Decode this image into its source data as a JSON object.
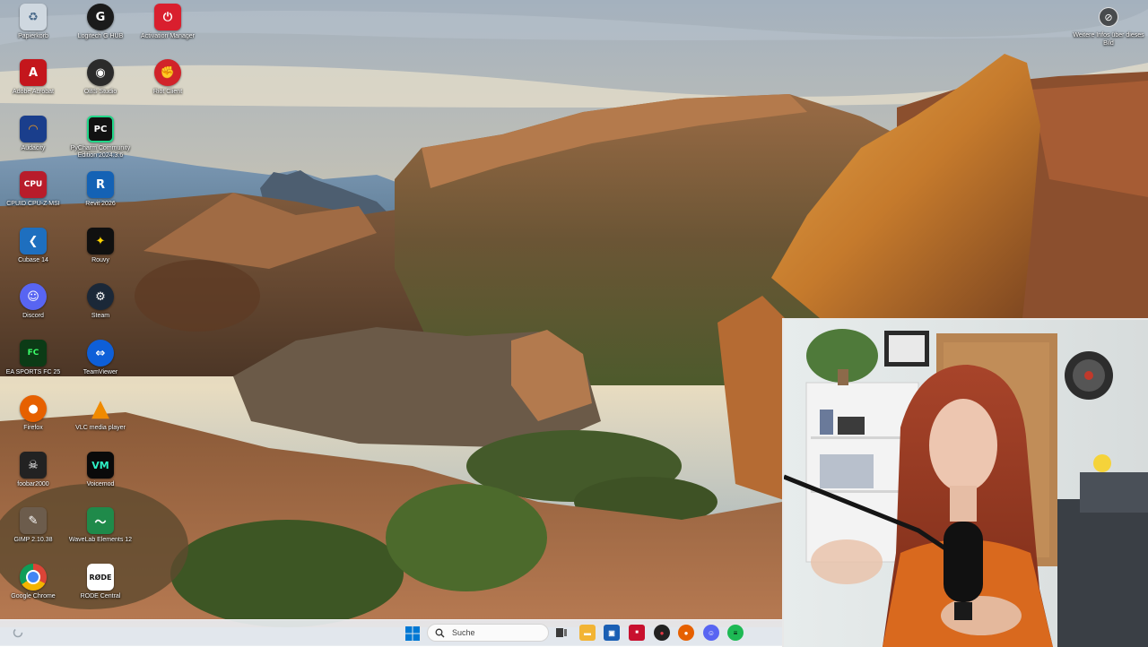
{
  "desktop": {
    "icons": [
      {
        "label": "Papierkorb",
        "icon": "recycle-bin-icon",
        "color": "#cfd8e0"
      },
      {
        "label": "Logitech G HUB",
        "icon": "logitech-g-icon",
        "color": "#1b1b1b"
      },
      {
        "label": "Activation Manager",
        "icon": "activation-manager-icon",
        "color": "#d91f2e"
      },
      {
        "label": "Adobe Acrobat",
        "icon": "adobe-acrobat-icon",
        "color": "#c4161c"
      },
      {
        "label": "OBS Studio",
        "icon": "obs-studio-icon",
        "color": "#2b2b2b"
      },
      {
        "label": "Riot Client",
        "icon": "riot-client-icon",
        "color": "#d1232a"
      },
      {
        "label": "Audacity",
        "icon": "audacity-icon",
        "color": "#1a3e8c"
      },
      {
        "label": "PyCharm Community Edition 2024.3.6",
        "icon": "pycharm-icon",
        "color": "#121212"
      },
      {
        "label": "CPUID CPU-Z MSI",
        "icon": "cpu-z-icon",
        "color": "#b81c2b"
      },
      {
        "label": "Revit 2026",
        "icon": "revit-icon",
        "color": "#1462b5"
      },
      {
        "label": "Cubase 14",
        "icon": "cubase-icon",
        "color": "#1e6fbf"
      },
      {
        "label": "Rouvy",
        "icon": "rouvy-icon",
        "color": "#101010"
      },
      {
        "label": "Discord",
        "icon": "discord-icon",
        "color": "#5865f2"
      },
      {
        "label": "Steam",
        "icon": "steam-icon",
        "color": "#1b2838"
      },
      {
        "label": "EA SPORTS FC 25",
        "icon": "ea-sports-fc-icon",
        "color": "#0c3b16"
      },
      {
        "label": "TeamViewer",
        "icon": "teamviewer-icon",
        "color": "#0e5fd8"
      },
      {
        "label": "Firefox",
        "icon": "firefox-icon",
        "color": "#e66000"
      },
      {
        "label": "VLC media player",
        "icon": "vlc-icon",
        "color": "#f08a00"
      },
      {
        "label": "foobar2000",
        "icon": "foobar2000-icon",
        "color": "#222222"
      },
      {
        "label": "Voicemod",
        "icon": "voicemod-icon",
        "color": "#0a0a0a"
      },
      {
        "label": "GIMP 2.10.38",
        "icon": "gimp-icon",
        "color": "#6c5c4c"
      },
      {
        "label": "WaveLab Elements 12",
        "icon": "wavelab-icon",
        "color": "#1f8a4a"
      },
      {
        "label": "Google Chrome",
        "icon": "chrome-icon",
        "color": "#ffffff"
      },
      {
        "label": "RODE Central",
        "icon": "rode-central-icon",
        "color": "#ffffff"
      }
    ],
    "info": {
      "label": "Weitere Infos über dieses Bild",
      "icon": "camera-info-icon"
    }
  },
  "taskbar": {
    "search_placeholder": "Suche",
    "pinned": [
      {
        "name": "task-view-icon",
        "color": "#3a3a3a"
      },
      {
        "name": "file-explorer-icon",
        "color": "#f2b434"
      },
      {
        "name": "store-icon",
        "color": "#1a5fb4"
      },
      {
        "name": "pinned-app-red-icon",
        "color": "#c8102e"
      },
      {
        "name": "pinned-app-dark-icon",
        "color": "#222222"
      },
      {
        "name": "firefox-taskbar-icon",
        "color": "#e66000"
      },
      {
        "name": "discord-taskbar-icon",
        "color": "#5865f2"
      },
      {
        "name": "spotify-taskbar-icon",
        "color": "#1db954"
      }
    ]
  },
  "accent": {
    "windows_blue": "#0078d4"
  }
}
